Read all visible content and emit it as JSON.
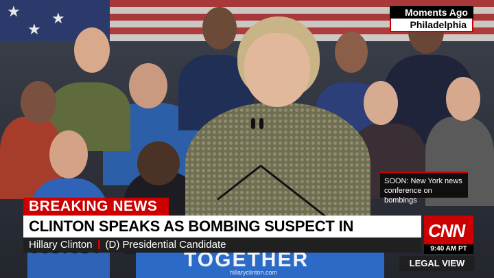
{
  "location_badge": {
    "time_label": "Moments Ago",
    "place": "Philadelphia"
  },
  "soon_box": {
    "text": "SOON: New York news conference on bombings"
  },
  "lower_third": {
    "breaking_label": "BREAKING NEWS",
    "headline": "CLINTON SPEAKS AS BOMBING SUSPECT IN CUSTODY",
    "speaker_name": "Hillary Clinton",
    "speaker_title": "(D) Presidential Candidate"
  },
  "network": {
    "logo_text": "CNN",
    "time": "9:40 AM PT",
    "show": "LEGAL VIEW",
    "brand_color": "#cc0000"
  },
  "podium": {
    "banner_text": "TOGETHER",
    "url": "hillaryclinton.com"
  }
}
